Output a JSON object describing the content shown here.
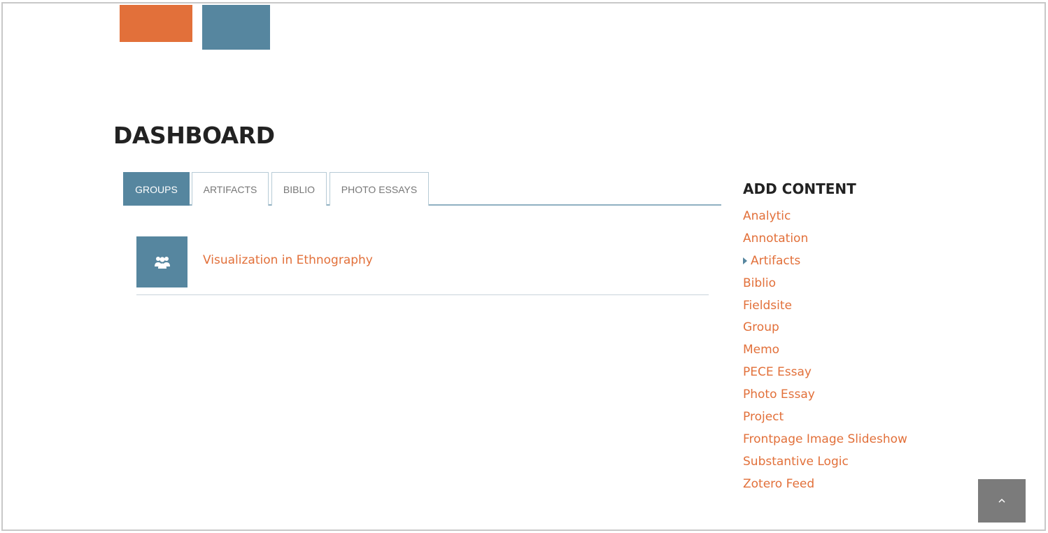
{
  "header": {
    "logo_colors": {
      "orange": "#e2703a",
      "blue": "#56869f"
    }
  },
  "page": {
    "title": "DASHBOARD"
  },
  "tabs": [
    {
      "label": "GROUPS",
      "active": true
    },
    {
      "label": "ARTIFACTS",
      "active": false
    },
    {
      "label": "BIBLIO",
      "active": false
    },
    {
      "label": "PHOTO ESSAYS",
      "active": false
    }
  ],
  "groups": [
    {
      "icon": "users-icon",
      "title": "Visualization in Ethnography"
    }
  ],
  "add_content": {
    "title": "ADD CONTENT",
    "items": [
      {
        "label": "Analytic"
      },
      {
        "label": "Annotation"
      },
      {
        "label": "Artifacts",
        "expandable": true
      },
      {
        "label": "Biblio"
      },
      {
        "label": "Fieldsite"
      },
      {
        "label": "Group"
      },
      {
        "label": "Memo"
      },
      {
        "label": "PECE Essay"
      },
      {
        "label": "Photo Essay"
      },
      {
        "label": "Project"
      },
      {
        "label": "Frontpage Image Slideshow"
      },
      {
        "label": "Substantive Logic"
      },
      {
        "label": "Zotero Feed"
      }
    ]
  },
  "scroll_top": {
    "icon": "chevron-up-icon"
  },
  "colors": {
    "accent": "#e2703a",
    "primary": "#56869f",
    "scroll_button": "#7b7b7b"
  }
}
